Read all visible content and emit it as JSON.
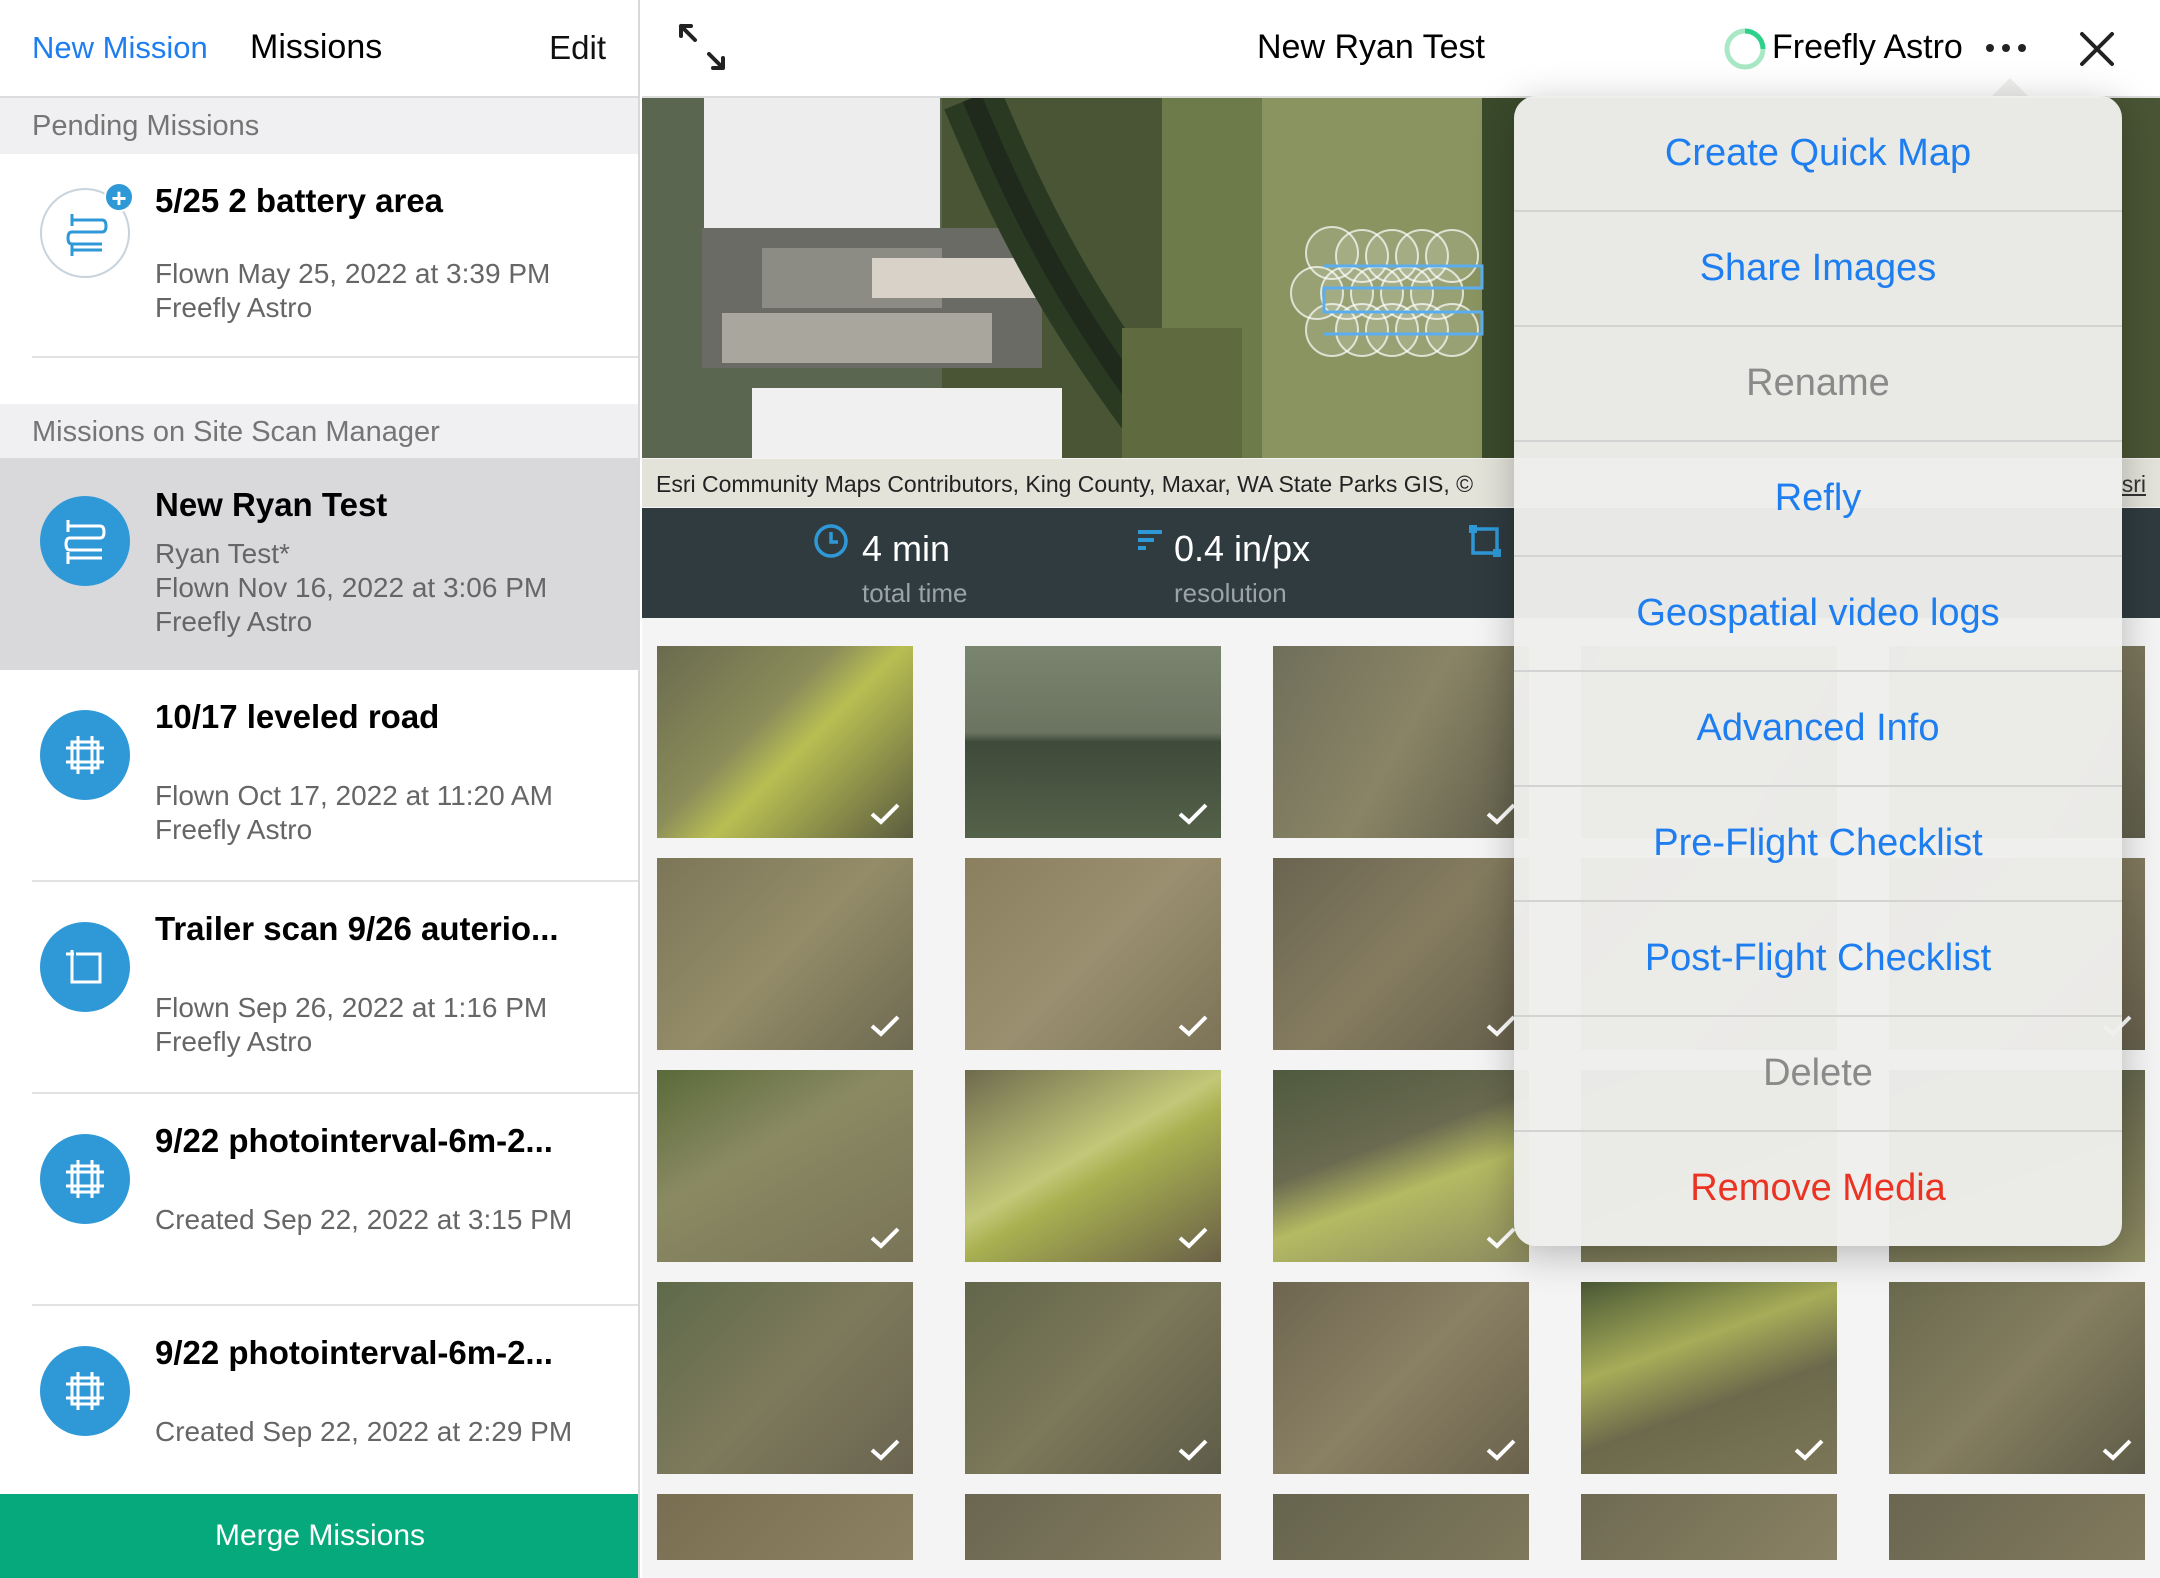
{
  "sidebar": {
    "new_mission_label": "New Mission",
    "title": "Missions",
    "edit_label": "Edit",
    "pending_header": "Pending Missions",
    "site_scan_header": "Missions on Site Scan Manager",
    "pending": [
      {
        "name": "5/25 2 battery area",
        "line1": "Flown May 25, 2022 at 3:39 PM",
        "line2": "Freefly Astro",
        "icon": "waypoint-path-icon"
      }
    ],
    "missions": [
      {
        "name": "New Ryan Test",
        "line1": "Ryan Test*",
        "line2": "Flown Nov 16, 2022 at 3:06 PM",
        "line3": "Freefly Astro",
        "icon": "waypoint-path-icon",
        "selected": true
      },
      {
        "name": "10/17 leveled road",
        "line1": "Flown Oct 17, 2022 at 11:20 AM",
        "line2": "Freefly Astro",
        "icon": "grid-survey-icon"
      },
      {
        "name": "Trailer scan 9/26 auterio...",
        "line1": "Flown Sep 26, 2022 at 1:16 PM",
        "line2": "Freefly Astro",
        "icon": "perimeter-icon"
      },
      {
        "name": "9/22 photointerval-6m-2...",
        "line1": "Created Sep 22, 2022 at 3:15 PM",
        "icon": "grid-survey-icon"
      },
      {
        "name": "9/22 photointerval-6m-2...",
        "line1": "Created Sep 22, 2022 at 2:29 PM",
        "icon": "grid-survey-icon"
      }
    ],
    "merge_label": "Merge Missions"
  },
  "topbar": {
    "title": "New Ryan Test",
    "device": "Freefly Astro"
  },
  "map": {
    "attribution": "Esri Community Maps Contributors, King County, Maxar, WA State Parks GIS, ©",
    "attribution_right": "sri"
  },
  "stats": {
    "time_value": "4 min",
    "time_label": "total time",
    "resolution_value": "0.4 in/px",
    "resolution_label": "resolution"
  },
  "menu": {
    "items": [
      {
        "label": "Create Quick Map",
        "state": "enabled"
      },
      {
        "label": "Share Images",
        "state": "enabled"
      },
      {
        "label": "Rename",
        "state": "disabled"
      },
      {
        "label": "Refly",
        "state": "enabled"
      },
      {
        "label": "Geospatial video logs",
        "state": "enabled"
      },
      {
        "label": "Advanced Info",
        "state": "enabled"
      },
      {
        "label": "Pre-Flight Checklist",
        "state": "enabled"
      },
      {
        "label": "Post-Flight Checklist",
        "state": "enabled"
      },
      {
        "label": "Delete",
        "state": "disabled"
      },
      {
        "label": "Remove Media",
        "state": "destructive"
      }
    ]
  },
  "colors": {
    "accent": "#1e7ef0",
    "icon_blue": "#2f99d8",
    "merge_green": "#06a97b",
    "destructive": "#ea3323",
    "stats_bg": "#2f3b3f"
  }
}
